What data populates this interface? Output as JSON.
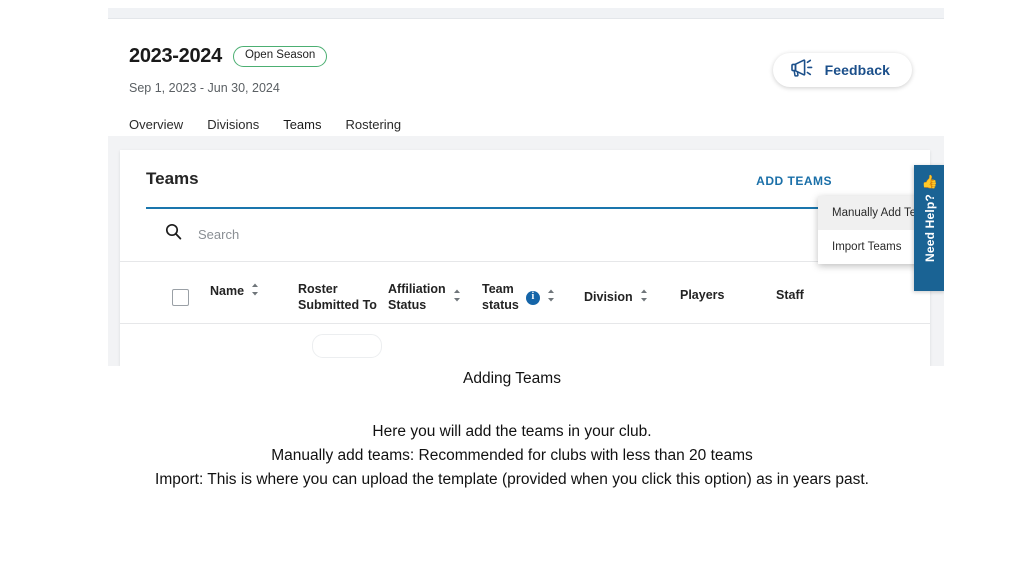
{
  "screenshot": {
    "season": {
      "title": "2023-2024",
      "badge": "Open Season",
      "dates": "Sep 1, 2023 - Jun 30, 2024"
    },
    "feedback": {
      "label": "Feedback",
      "icon": "megaphone-icon"
    },
    "nav_tabs": [
      {
        "label": "Overview",
        "active": false
      },
      {
        "label": "Divisions",
        "active": false
      },
      {
        "label": "Teams",
        "active": true
      },
      {
        "label": "Rostering",
        "active": false
      }
    ],
    "card": {
      "title": "Teams",
      "add_teams_label": "ADD TEAMS",
      "search_placeholder": "Search",
      "filter_icon": "filter-icon",
      "search_icon": "search-icon"
    },
    "dropdown": {
      "items": [
        {
          "label": "Manually Add Teams",
          "hovered": true
        },
        {
          "label": "Import Teams",
          "hovered": false
        }
      ]
    },
    "need_help": {
      "label": "Need Help?",
      "emoji": "👍"
    },
    "table": {
      "columns": [
        {
          "label": "Name",
          "sortable": true,
          "info": false
        },
        {
          "label": "Roster\nSubmitted To",
          "sortable": false,
          "info": false
        },
        {
          "label": "Affiliation\nStatus",
          "sortable": true,
          "info": false
        },
        {
          "label": "Team\nstatus",
          "sortable": true,
          "info": true
        },
        {
          "label": "Division",
          "sortable": true,
          "info": false
        },
        {
          "label": "Players",
          "sortable": false,
          "info": false
        },
        {
          "label": "Staff",
          "sortable": false,
          "info": false
        }
      ]
    },
    "colors": {
      "accent_blue": "#1a76ad",
      "link_blue": "#1a6fa8",
      "feedback_blue": "#1b4f8a",
      "badge_green": "#4caf72",
      "need_help_blue": "#1a6394",
      "info_blue": "#1565a8",
      "page_gray": "#f2f3f5"
    }
  },
  "caption": {
    "title": "Adding Teams",
    "lines": [
      "Here you will add the teams in your club.",
      "Manually add teams: Recommended for clubs with less than 20 teams",
      "Import: This is where you can upload the template (provided when you click this option) as in years past."
    ]
  }
}
